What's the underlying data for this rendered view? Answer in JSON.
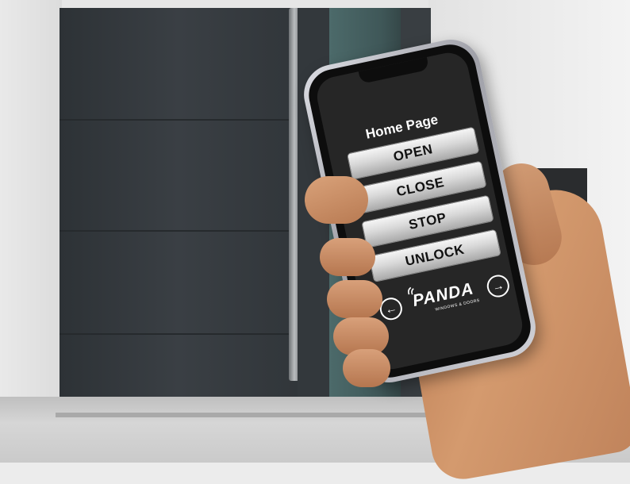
{
  "app": {
    "page_title": "Home Page",
    "buttons": {
      "open": "OPEN",
      "close": "CLOSE",
      "stop": "STOP",
      "unlock": "UNLOCK"
    },
    "nav": {
      "back_icon": "arrow-left-icon",
      "forward_icon": "arrow-right-icon",
      "back_glyph": "←",
      "forward_glyph": "→"
    },
    "logo": {
      "name": "PANDA",
      "tagline": "WINDOWS & DOORS"
    }
  },
  "colors": {
    "screen_bg": "#262626",
    "button_gradient_top": "#f5f5f5",
    "button_gradient_bottom": "#a9a9a9",
    "text_light": "#ffffff"
  }
}
